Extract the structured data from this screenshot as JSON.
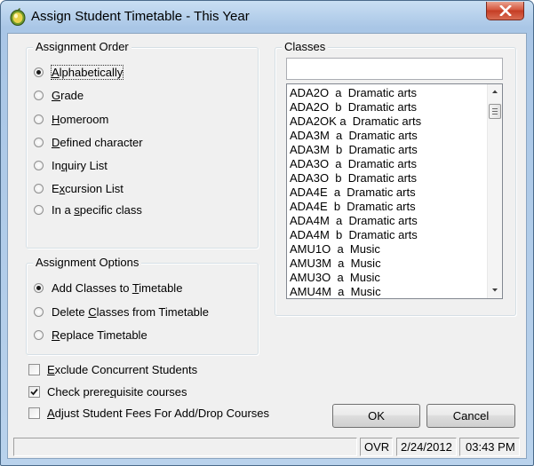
{
  "window": {
    "title": "Assign Student Timetable - This Year"
  },
  "assignment_order": {
    "legend": "Assignment Order",
    "selected": "Alphabetically",
    "options": [
      {
        "pre": "",
        "key": "A",
        "post": "lphabetically"
      },
      {
        "pre": "",
        "key": "G",
        "post": "rade"
      },
      {
        "pre": "",
        "key": "H",
        "post": "omeroom"
      },
      {
        "pre": "",
        "key": "D",
        "post": "efined character"
      },
      {
        "pre": "In",
        "key": "q",
        "post": "uiry List"
      },
      {
        "pre": "E",
        "key": "x",
        "post": "cursion List"
      },
      {
        "pre": "In a ",
        "key": "s",
        "post": "pecific class"
      }
    ]
  },
  "assignment_options": {
    "legend": "Assignment Options",
    "selected": "Add Classes to Timetable",
    "options": [
      {
        "pre": "Add Classes to ",
        "key": "T",
        "post": "imetable"
      },
      {
        "pre": "Delete ",
        "key": "C",
        "post": "lasses from Timetable"
      },
      {
        "pre": "",
        "key": "R",
        "post": "eplace Timetable"
      }
    ]
  },
  "checkboxes": [
    {
      "pre": "",
      "key": "E",
      "post": "xclude Concurrent Students",
      "checked": false
    },
    {
      "pre": "Check prere",
      "key": "q",
      "post": "uisite courses",
      "checked": true
    },
    {
      "pre": "",
      "key": "A",
      "post": "djust Student Fees For Add/Drop Courses",
      "checked": false
    }
  ],
  "classes": {
    "legend": "Classes",
    "filter_value": "",
    "items": [
      "ADA2O  a  Dramatic arts",
      "ADA2O  b  Dramatic arts",
      "ADA2OK a  Dramatic arts",
      "ADA3M  a  Dramatic arts",
      "ADA3M  b  Dramatic arts",
      "ADA3O  a  Dramatic arts",
      "ADA3O  b  Dramatic arts",
      "ADA4E  a  Dramatic arts",
      "ADA4E  b  Dramatic arts",
      "ADA4M  a  Dramatic arts",
      "ADA4M  b  Dramatic arts",
      "AMU1O  a  Music",
      "AMU3M  a  Music",
      "AMU3O  a  Music",
      "AMU4M  a  Music"
    ]
  },
  "buttons": {
    "ok": "OK",
    "cancel": "Cancel"
  },
  "status": {
    "message": "",
    "mode": "OVR",
    "date": "2/24/2012",
    "time": "03:43 PM"
  },
  "icons": {
    "app": "app-icon",
    "close": "close-icon"
  },
  "colors": {
    "title_gradient_top": "#c9dff3",
    "close_button": "#c53d24",
    "dialog_face": "#f0f0f0"
  }
}
